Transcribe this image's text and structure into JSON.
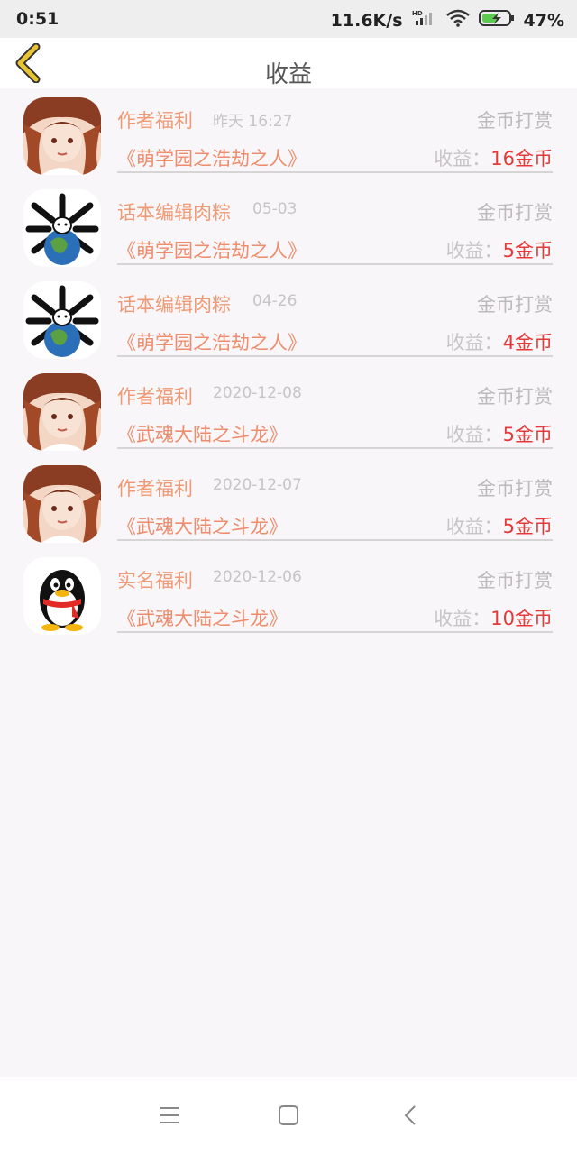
{
  "status_bar": {
    "time": "0:51",
    "network_speed": "11.6K/s",
    "signal_tag": "HD",
    "battery": "47%"
  },
  "header": {
    "title": "收益",
    "back_icon": "chevron-left-icon"
  },
  "items": [
    {
      "type": "作者福利",
      "date": "昨天 16:27",
      "category": "金币打赏",
      "book": "《萌学园之浩劫之人》",
      "income_label": "收益：",
      "amount": "16金币",
      "avatar": "anime-girl"
    },
    {
      "type": "话本编辑肉粽",
      "date": "05-03",
      "category": "金币打赏",
      "book": "《萌学园之浩劫之人》",
      "income_label": "收益：",
      "amount": "5金币",
      "avatar": "bones-earth"
    },
    {
      "type": "话本编辑肉粽",
      "date": "04-26",
      "category": "金币打赏",
      "book": "《萌学园之浩劫之人》",
      "income_label": "收益：",
      "amount": "4金币",
      "avatar": "bones-earth"
    },
    {
      "type": "作者福利",
      "date": "2020-12-08",
      "category": "金币打赏",
      "book": "《武魂大陆之斗龙》",
      "income_label": "收益：",
      "amount": "5金币",
      "avatar": "anime-girl"
    },
    {
      "type": "作者福利",
      "date": "2020-12-07",
      "category": "金币打赏",
      "book": "《武魂大陆之斗龙》",
      "income_label": "收益：",
      "amount": "5金币",
      "avatar": "anime-girl"
    },
    {
      "type": "实名福利",
      "date": "2020-12-06",
      "category": "金币打赏",
      "book": "《武魂大陆之斗龙》",
      "income_label": "收益：",
      "amount": "10金币",
      "avatar": "qq-penguin"
    }
  ],
  "colors": {
    "accent": "#ef9a74",
    "amount": "#e53a3a",
    "back_icon": "#e7c431"
  }
}
